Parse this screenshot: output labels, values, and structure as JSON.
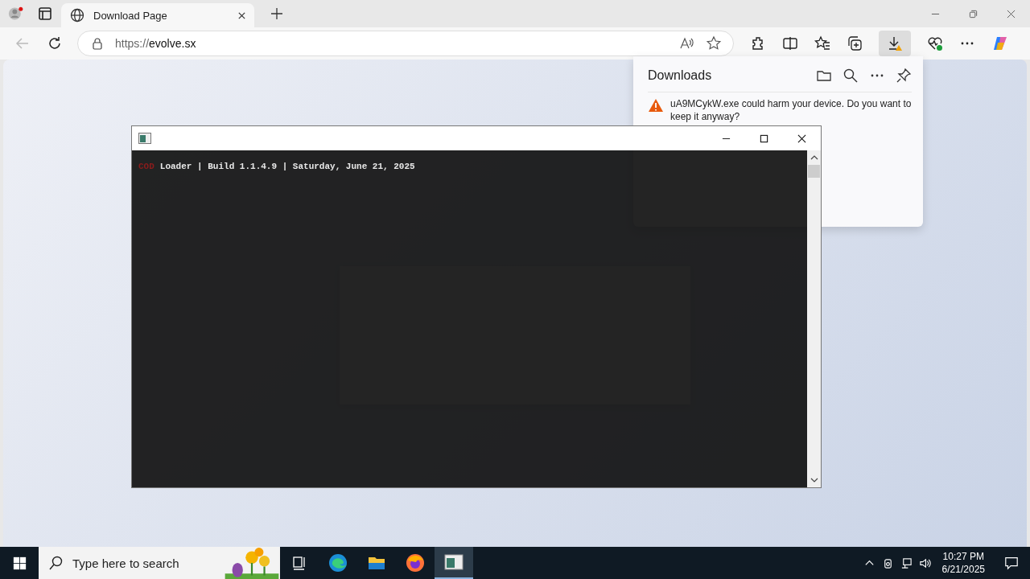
{
  "browser": {
    "tabs": [
      {
        "title": "Download Page",
        "selected": true
      }
    ],
    "url_scheme": "https://",
    "url_host": "evolve.sx"
  },
  "downloads": {
    "title": "Downloads",
    "warning": "uA9MCykW.exe could harm your device. Do you want to keep it anyway?"
  },
  "console": {
    "lines": [
      {
        "parts": [
          {
            "text": "COD",
            "color": "#8a1c1c"
          },
          {
            "text": "Loader | Build 1.1.4.9 | Saturday, June 21, 2025",
            "color": "#e8e8e8"
          }
        ]
      }
    ]
  },
  "taskbar": {
    "search_placeholder": "Type here to search",
    "apps": [
      {
        "kind": "edge",
        "selected": false
      },
      {
        "kind": "folder",
        "selected": false
      },
      {
        "kind": "firefox",
        "selected": false
      },
      {
        "kind": "console",
        "selected": true
      }
    ],
    "time": "10:27 PM",
    "date": "6/21/2025"
  }
}
